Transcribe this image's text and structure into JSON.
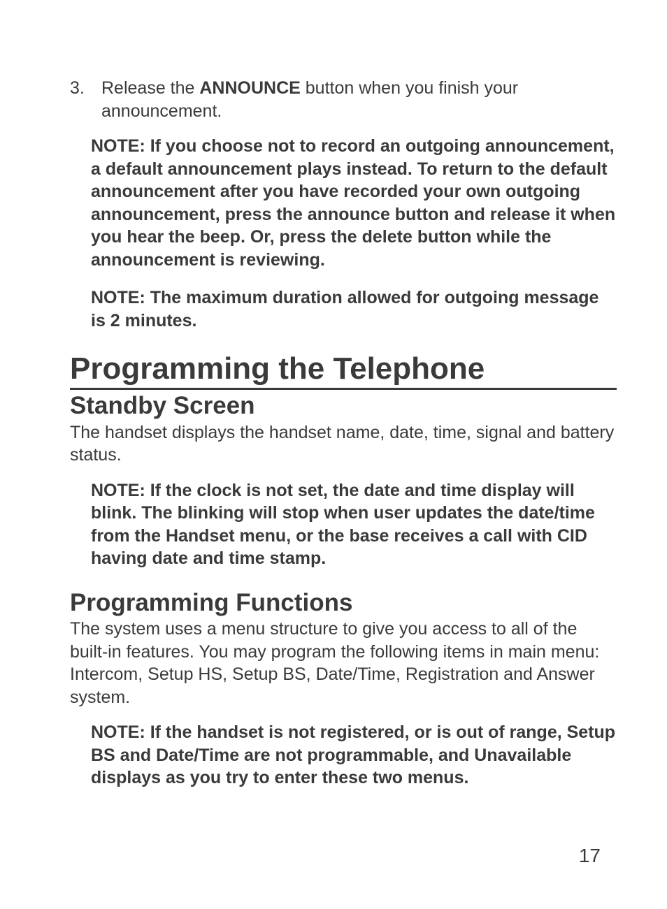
{
  "step3": {
    "marker": "3.",
    "pre": "Release the ",
    "bold": "ANNOUNCE",
    "post": " button when you finish your announcement."
  },
  "note1": "NOTE: If you choose not to record an outgoing announcement, a default announcement plays instead. To return to the default announcement after you have recorded your own outgoing announcement, press the announce button and release it when you hear the beep. Or, press the delete button while the announcement is reviewing.",
  "note2": "NOTE: The maximum duration allowed for outgoing message is 2 minutes.",
  "heading1": "Programming the Telephone",
  "sec1": {
    "title": "Standby Screen",
    "body": "The handset displays the handset name, date, time, signal and battery status.",
    "note": "NOTE: If the clock is not set, the date and time display will blink. The blinking will stop when user updates the date/time from the Handset menu, or the base receives a call with CID having date and time stamp."
  },
  "sec2": {
    "title": "Programming Functions",
    "body": "The system uses a menu structure to give you access to all of the built-in features. You may program the following items in main menu: Intercom, Setup HS, Setup BS, Date/Time, Registration and Answer system.",
    "note": "NOTE: If the handset is not registered, or is out of range, Setup BS and Date/Time are not programmable, and Unavailable displays as you try to enter these two menus."
  },
  "pageNumber": "17"
}
